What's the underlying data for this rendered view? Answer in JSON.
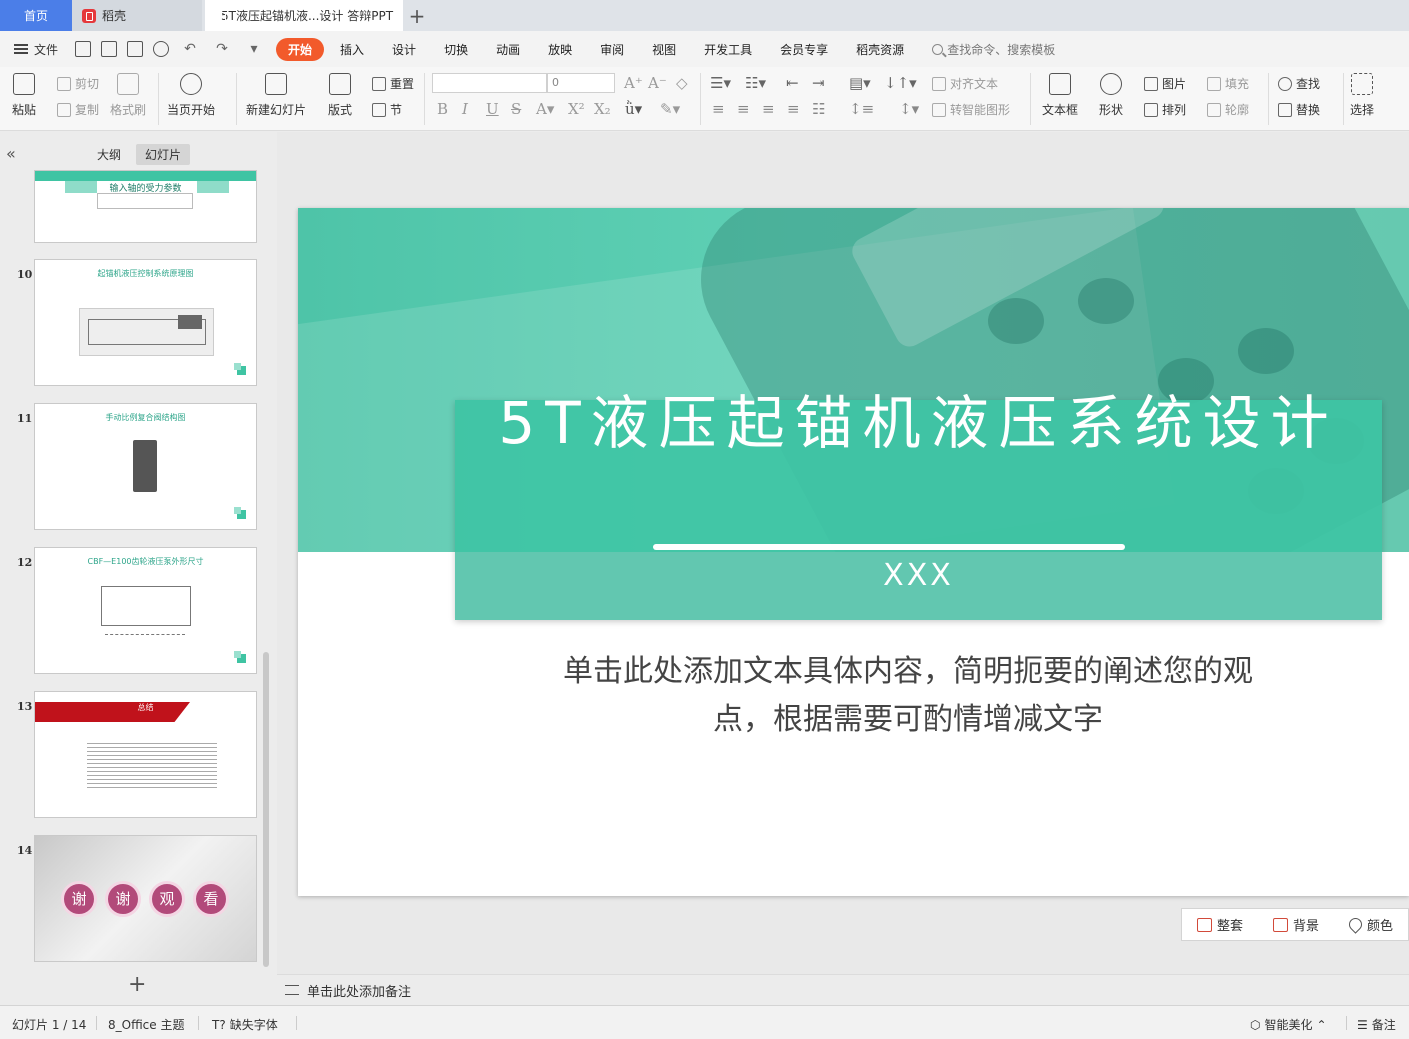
{
  "tabs": {
    "home": "首页",
    "daoke": "稻壳",
    "document": "5T液压起锚机液...设计 答辩PPT",
    "add": "+"
  },
  "menu": {
    "file": "文件",
    "tabs": [
      "开始",
      "插入",
      "设计",
      "切换",
      "动画",
      "放映",
      "审阅",
      "视图",
      "开发工具",
      "会员专享",
      "稻壳资源"
    ],
    "active_tab": "开始",
    "search_placeholder": "查找命令、搜索模板"
  },
  "ribbon": {
    "paste": "粘贴",
    "cut": "剪切",
    "copy": "复制",
    "format_painter": "格式刷",
    "from_start": "当页开始",
    "new_slide": "新建幻灯片",
    "layout": "版式",
    "reset": "重置",
    "section": "节",
    "font_name": "",
    "font_size": "0",
    "align_text": "对齐文本",
    "to_smartart": "转智能图形",
    "textbox": "文本框",
    "shape": "形状",
    "picture": "图片",
    "arrange": "排列",
    "fill": "填充",
    "outline": "轮廓",
    "find": "查找",
    "replace": "替换",
    "select": "选择"
  },
  "left_panel": {
    "collapse": "«",
    "outline_tab": "大纲",
    "slides_tab": "幻灯片",
    "add_slide": "+",
    "thumbnails": [
      {
        "num": "",
        "title": "输入轴的受力参数"
      },
      {
        "num": "10",
        "title": "起锚机液压控制系统原理图"
      },
      {
        "num": "11",
        "title": "手动比例复合阀结构图"
      },
      {
        "num": "12",
        "title": "CBF—E100齿轮液压泵外形尺寸"
      },
      {
        "num": "13",
        "title": "总结"
      },
      {
        "num": "14",
        "title": "",
        "chars": [
          "谢",
          "谢",
          "观",
          "看"
        ]
      }
    ]
  },
  "slide": {
    "title": "5T液压起锚机液压系统设计",
    "subtitle": "XXX",
    "body": "单击此处添加文本具体内容，简明扼要的阐述您的观点，根据需要可酌情增减文字",
    "colors": {
      "accent": "#3ec4a4",
      "band": "#62c7b0"
    }
  },
  "slide_tools": {
    "tidy": "整套",
    "background": "背景",
    "color": "颜色"
  },
  "notes": {
    "placeholder": "单击此处添加备注"
  },
  "statusbar": {
    "slide_counter": "幻灯片 1 / 14",
    "theme": "8_Office 主题",
    "missing_font": "缺失字体",
    "smart_beautify": "智能美化",
    "notes": "备注"
  }
}
